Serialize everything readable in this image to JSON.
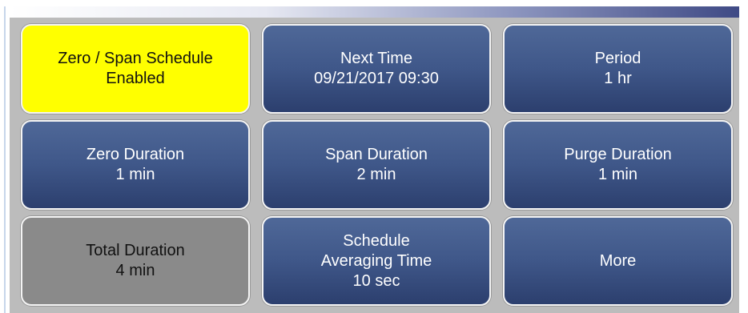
{
  "colors": {
    "tile_blue": "#3f5789",
    "tile_yellow": "#ffff00",
    "tile_gray": "#8a8a8a",
    "panel_background": "#bcbcbc",
    "text_light": "#ffffff",
    "text_dark": "#111111"
  },
  "tiles": {
    "schedule_status": {
      "line1": "Zero / Span Schedule",
      "line2": "Enabled"
    },
    "next_time": {
      "line1": "Next Time",
      "line2": "09/21/2017 09:30"
    },
    "period": {
      "line1": "Period",
      "line2": "1 hr"
    },
    "zero_duration": {
      "line1": "Zero Duration",
      "line2": "1 min"
    },
    "span_duration": {
      "line1": "Span Duration",
      "line2": "2 min"
    },
    "purge_duration": {
      "line1": "Purge Duration",
      "line2": "1 min"
    },
    "total_duration": {
      "line1": "Total Duration",
      "line2": "4 min"
    },
    "schedule_averaging_time": {
      "line1": "Schedule",
      "line2": "Averaging Time",
      "line3": "10 sec"
    },
    "more": {
      "line1": "More"
    }
  }
}
